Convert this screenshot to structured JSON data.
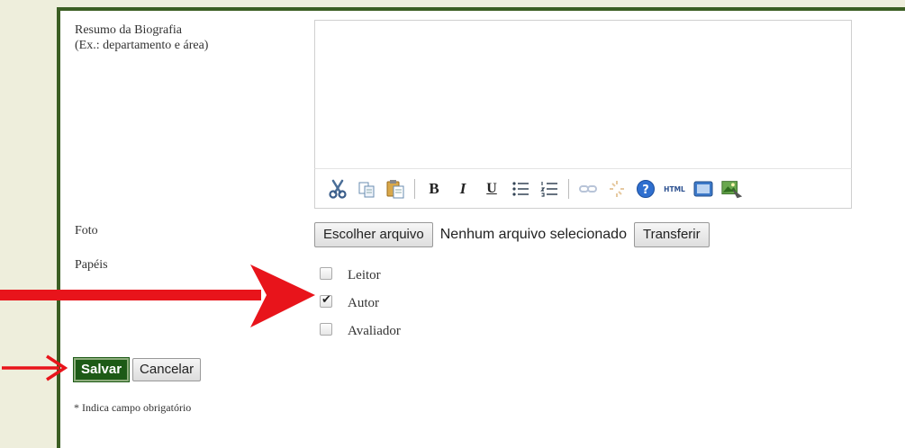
{
  "form": {
    "bio_label_line1": "Resumo da Biografia",
    "bio_label_line2": "(Ex.: departamento e área)",
    "bio_value": "",
    "photo_label": "Foto",
    "choose_file_label": "Escolher arquivo",
    "no_file_text": "Nenhum arquivo selecionado",
    "upload_label": "Transferir",
    "roles_label": "Papéis",
    "roles": [
      {
        "label": "Leitor",
        "checked": false
      },
      {
        "label": "Autor",
        "checked": true
      },
      {
        "label": "Avaliador",
        "checked": false
      }
    ],
    "save_label": "Salvar",
    "cancel_label": "Cancelar",
    "required_note": "* Indica campo obrigatório"
  },
  "toolbar_icons": [
    "cut-icon",
    "copy-icon",
    "paste-icon",
    "bold-icon",
    "italic-icon",
    "underline-icon",
    "bullet-list-icon",
    "numbered-list-icon",
    "link-icon",
    "unlink-icon",
    "help-icon",
    "html-icon",
    "fullscreen-icon",
    "image-icon"
  ],
  "colors": {
    "frame": "#3b5e23",
    "save_button": "#1d5a16",
    "arrow": "#e8141b",
    "page_bg": "#eeeedc"
  }
}
